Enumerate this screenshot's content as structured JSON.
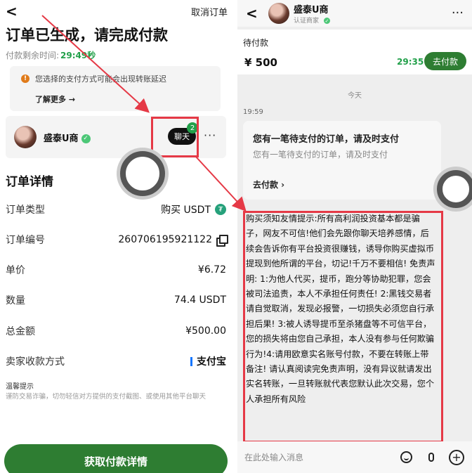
{
  "order_page": {
    "back": "<",
    "cancel": "取消订单",
    "title": "订单已生成，请完成付款",
    "timer_label": "付款剩余时间:",
    "timer_value": "29:49秒",
    "warning": {
      "text": "您选择的支付方式可能会出现转账延迟",
      "more": "了解更多 →"
    },
    "seller": {
      "name": "盛泰U商",
      "chat": "聊天",
      "badge": "2"
    },
    "details_title": "订单详情",
    "rows": [
      {
        "k": "订单类型",
        "v": "购买 USDT"
      },
      {
        "k": "订单编号",
        "v": "260706195921122"
      },
      {
        "k": "单价",
        "v": "¥6.72"
      },
      {
        "k": "数量",
        "v": "74.4 USDT"
      },
      {
        "k": "总金额",
        "v": "¥500.00"
      },
      {
        "k": "卖家收款方式",
        "v": "支付宝"
      }
    ],
    "tip_title": "温馨提示",
    "tip_text": "谨防交易诈骗，切勿轻信对方提供的支付截图、或使用其他平台聊天",
    "pay_button": "获取付款详情"
  },
  "chat_page": {
    "back": "<",
    "name": "盛泰U商",
    "sub": "认证商家",
    "pending": {
      "label": "待付款",
      "amount": "¥ 500",
      "timer": "29:35",
      "button": "去付款"
    },
    "day": "今天",
    "time": "19:59",
    "card": {
      "title": "您有一笔待支付的订单，请及时支付",
      "subtitle": "您有一笔待支付的订单，请及时支付",
      "link": "去付款  ›"
    },
    "warning_message": "购买须知友情提示:所有高利润投资基本都是骗子，网友不可信!他们会先跟你聊天培养感情，后续会告诉你有平台投资很赚钱，诱导你购买虚拟币提现到他所谓的平台，切记!千万不要相信! 免责声明: 1:为他人代买，提币，跑分等协助犯罪，您会被司法追责，本人不承担任何责任! 2:黑钱交易者请自觉取消，发现必报警，一切损失必须您自行承担后果! 3:被人诱导提币至杀猪盘等不可信平台，您的损失将由您自己承担，本人没有参与任何欺骗行为!4:请用欧意实名账号付款，不要在转账上带备注! 请认真阅读完免责声明，没有异议就请发出实名转账，一旦转账就代表您默认此次交易，您个人承担所有风险",
    "input_placeholder": "在此处输入消息"
  },
  "icons": [
    "back-icon",
    "warning-icon",
    "verified-icon",
    "tether-icon",
    "copy-icon",
    "emoji-icon",
    "mic-icon",
    "plus-icon",
    "more-icon"
  ],
  "colors": {
    "accent_green": "#2e7d32",
    "timer_green": "#22a04a",
    "annotation_red": "#e53946"
  }
}
